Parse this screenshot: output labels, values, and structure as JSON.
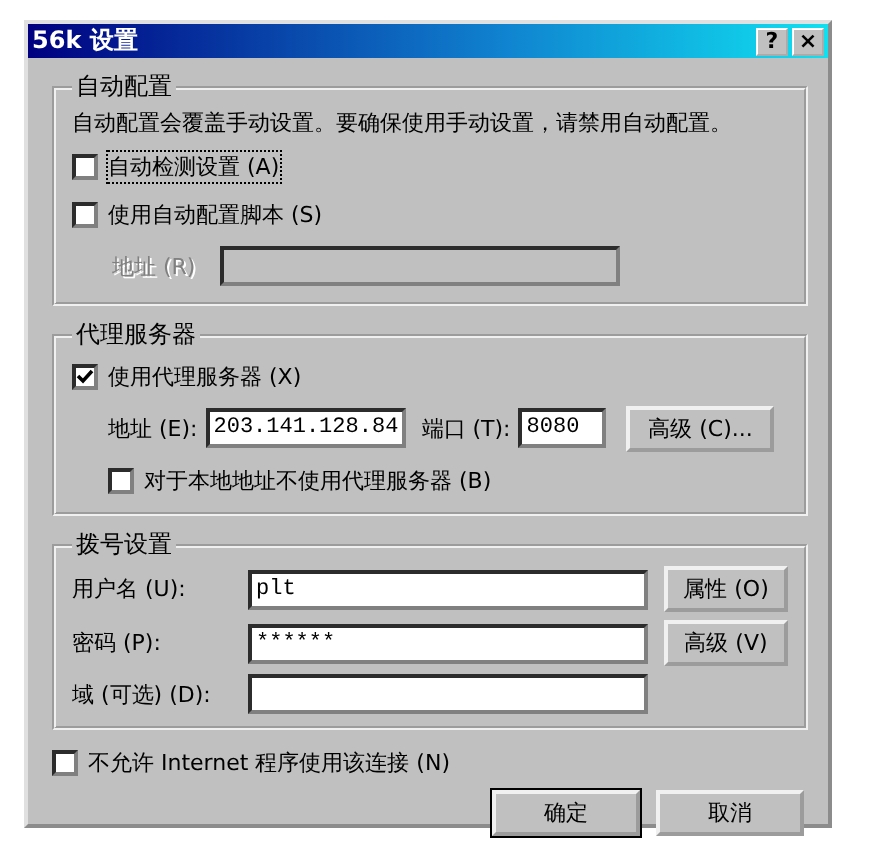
{
  "window": {
    "title": "56k 设置",
    "title_buttons": [
      "?",
      "×"
    ]
  },
  "auto_config": {
    "title": "自动配置",
    "description": "自动配置会覆盖手动设置。要确保使用手动设置，请禁用自动配置。",
    "options": [
      {
        "label": "自动检测设置 (A)",
        "checked": false,
        "focused": true
      },
      {
        "label": "使用自动配置脚本 (S)",
        "checked": false,
        "focused": false
      }
    ],
    "address": {
      "label": "地址 (R)",
      "disabled": true
    }
  },
  "proxy": {
    "title": "代理服务器",
    "use_proxy": {
      "label": "使用代理服务器 (X)",
      "checked": true
    },
    "address_label": "地址 (E):",
    "address": "203.141.128.84",
    "port_label": "端口 (T):",
    "port": "8080",
    "advanced_button": "高级 (C)...",
    "bypass": {
      "label": "对于本地地址不使用代理服务器 (B)",
      "checked": false
    }
  },
  "dialup": {
    "title": "拨号设置",
    "fields": [
      {
        "label": "用户名 (U):",
        "value": "plt"
      },
      {
        "label": "密码 (P):",
        "value": "******"
      },
      {
        "label": "域 (可选) (D):"
      }
    ],
    "buttons": [
      "属性 (O)",
      "高级 (V)"
    ]
  },
  "block_internet": {
    "label": "不允许 Internet 程序使用该连接 (N)",
    "checked": false
  },
  "buttons": [
    {
      "label": "确定",
      "default": true
    },
    {
      "label": "取消",
      "default": false
    }
  ]
}
